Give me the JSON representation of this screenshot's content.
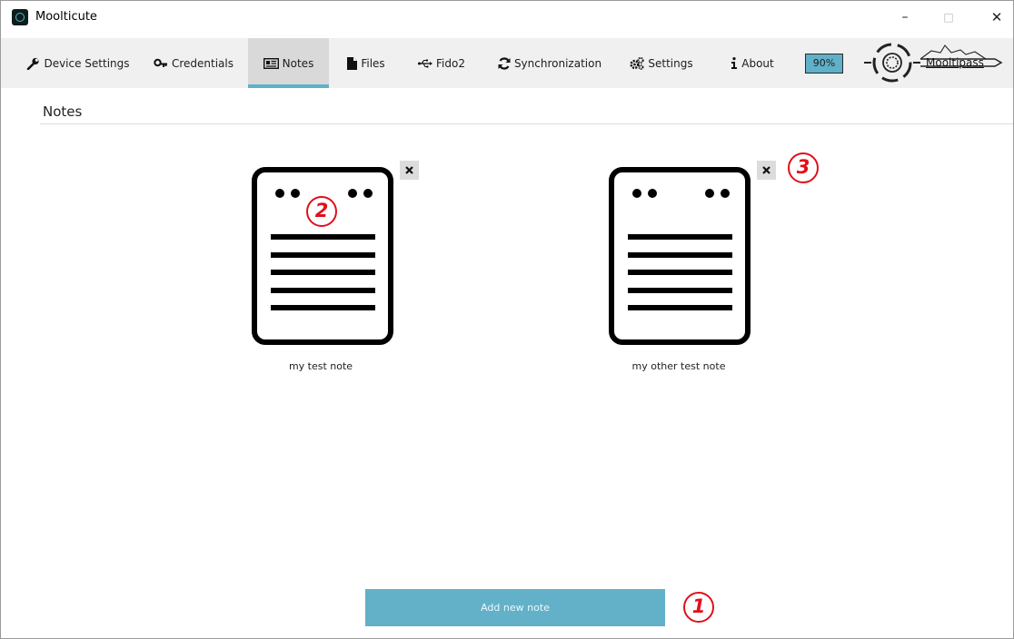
{
  "window": {
    "title": "Moolticute",
    "minimize": "–",
    "maximize": "□",
    "close": "✕"
  },
  "nav": {
    "tabs": [
      {
        "label": "Device Settings",
        "icon": "wrench-icon"
      },
      {
        "label": "Credentials",
        "icon": "key-icon"
      },
      {
        "label": "Notes",
        "icon": "note-card-icon",
        "active": true
      },
      {
        "label": "Files",
        "icon": "file-icon"
      },
      {
        "label": "Fido2",
        "icon": "usb-icon"
      },
      {
        "label": "Synchronization",
        "icon": "refresh-icon"
      },
      {
        "label": "Settings",
        "icon": "gears-icon"
      },
      {
        "label": "About",
        "icon": "info-icon"
      }
    ],
    "battery": "90%",
    "logo_text": "Mooltipass"
  },
  "content": {
    "section_title": "Notes",
    "notes": [
      {
        "name": "my test note",
        "delete_icon": "close-icon"
      },
      {
        "name": "my other test note",
        "delete_icon": "close-icon"
      }
    ],
    "add_button": "Add new note"
  },
  "annotations": {
    "m1": "1",
    "m2": "2",
    "m3": "3",
    "color": "#e0101a"
  },
  "colors": {
    "accent": "#62b1c8",
    "tab_active_bg": "#d9d9d9",
    "nav_bg": "#f0f0f0"
  }
}
